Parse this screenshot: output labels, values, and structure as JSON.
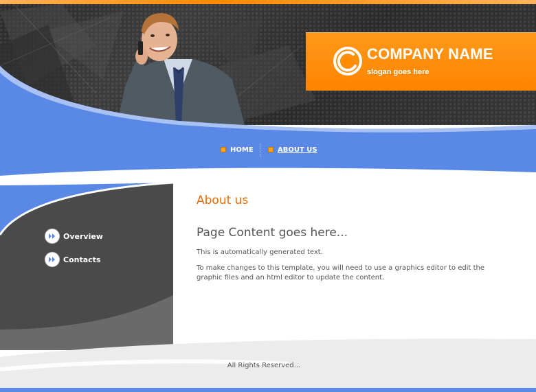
{
  "brand": {
    "company_name": "COMPANY NAME",
    "slogan": "slogan goes here"
  },
  "nav": {
    "items": [
      {
        "label": "HOME"
      },
      {
        "label": "ABOUT US"
      }
    ]
  },
  "sidebar": {
    "items": [
      {
        "label": "Overview"
      },
      {
        "label": "Contacts"
      }
    ]
  },
  "content": {
    "section_title": "About us",
    "heading": "Page Content goes here...",
    "paragraphs": [
      "This is automatically generated text.",
      "To make changes to this template, you will need to use a graphics editor to edit the graphic files and an html editor to update the content."
    ]
  },
  "footer": {
    "copyright": "All Rights Reserved..."
  },
  "colors": {
    "accent_orange": "#ff8a00",
    "nav_blue": "#5a88e6",
    "dark_gray": "#3a3a3a"
  }
}
